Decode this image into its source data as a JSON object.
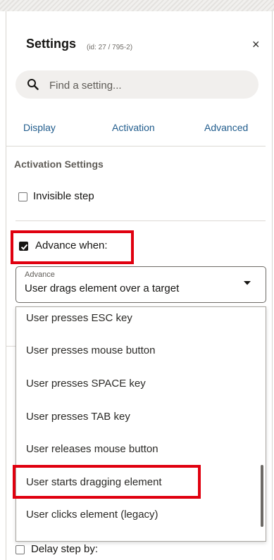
{
  "panel": {
    "title": "Settings",
    "id_text": "(id: 27 / 795-2)",
    "close_glyph": "×"
  },
  "search": {
    "placeholder": "Find a setting...",
    "icon": "search-icon"
  },
  "tabs": [
    {
      "label": "Display"
    },
    {
      "label": "Activation"
    },
    {
      "label": "Advanced"
    }
  ],
  "activation": {
    "section_title": "Activation Settings",
    "invisible_step": {
      "label": "Invisible step",
      "checked": false
    },
    "advance_when": {
      "label": "Advance when:",
      "checked": true
    },
    "advance_select": {
      "label": "Advance",
      "value": "User drags element over a target"
    },
    "options": [
      "User presses ESC key",
      "User presses mouse button",
      "User presses SPACE key",
      "User presses TAB key",
      "User releases mouse button",
      "User starts dragging element",
      "User clicks element (legacy)"
    ],
    "delay_step": {
      "label": "Delay step by:",
      "checked": false
    }
  },
  "colors": {
    "tab_link": "#1f5b8c",
    "highlight_box": "#e0000f"
  }
}
